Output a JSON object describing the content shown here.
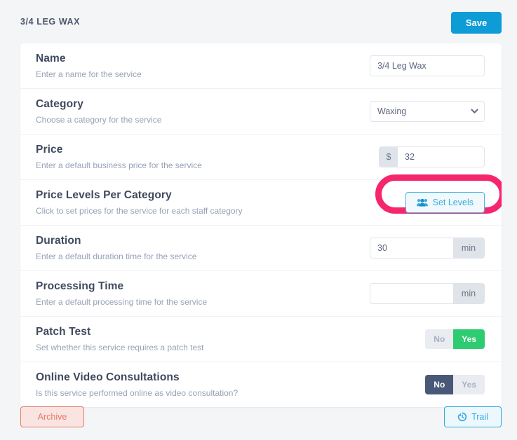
{
  "header": {
    "title": "3/4 LEG WAX",
    "save_label": "Save",
    "save_color": "#0e9cd7"
  },
  "form": {
    "rows": [
      {
        "title": "Name",
        "description": "Enter a name for the service",
        "value": "3/4 Leg Wax"
      },
      {
        "title": "Category",
        "description": "Choose a category for the service",
        "value": "Waxing"
      },
      {
        "title": "Price",
        "description": "Enter a default business price for the service",
        "prefix": "$",
        "value": "32"
      },
      {
        "title": "Price Levels Per Category",
        "description": "Click to set prices for the service for each staff category",
        "button_label": "Set Levels",
        "button_icon": "users-icon",
        "highlight_color": "#f5266d"
      },
      {
        "title": "Duration",
        "description": "Enter a default duration time for the service",
        "value": "30",
        "suffix": "min"
      },
      {
        "title": "Processing Time",
        "description": "Enter a default processing time for the service",
        "value": "",
        "suffix": "min"
      },
      {
        "title": "Patch Test",
        "description": "Set whether this service requires a patch test",
        "options": [
          "No",
          "Yes"
        ],
        "selected": "Yes",
        "active_color": "#2ecc71"
      },
      {
        "title": "Online Video Consultations",
        "description": "Is this service performed online as video consultation?",
        "options": [
          "No",
          "Yes"
        ],
        "selected": "No",
        "active_color": "#4a5878"
      }
    ]
  },
  "footer": {
    "archive_label": "Archive",
    "archive_color": "#e8796a",
    "trail_label": "Trail",
    "trail_icon": "history-icon",
    "trail_color": "#3aabe0"
  }
}
